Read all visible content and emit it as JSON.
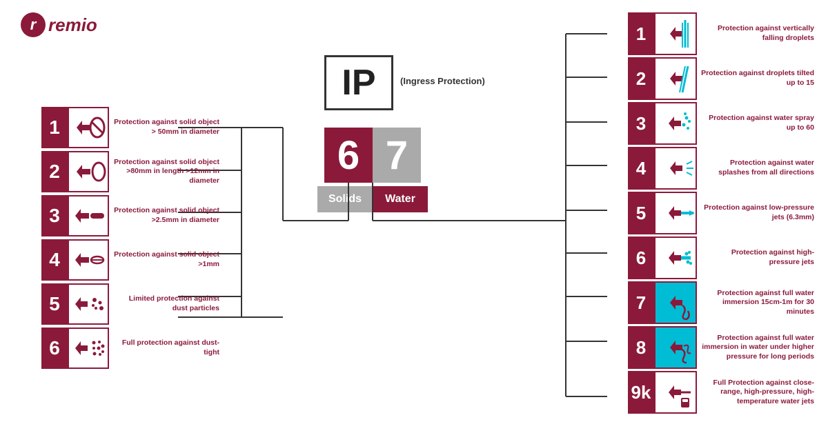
{
  "logo": {
    "p_letter": "r",
    "brand": "remio"
  },
  "ip": {
    "label": "IP",
    "subtitle": "(Ingress Protection)"
  },
  "digits": {
    "solid_digit": "6",
    "water_digit": "7",
    "solid_label": "Solids",
    "water_label": "Water"
  },
  "solids": [
    {
      "num": "1",
      "desc": "Protection against solid object > 50mm in diameter"
    },
    {
      "num": "2",
      "desc": "Protection against solid object >80mm in length >12mm in diameter"
    },
    {
      "num": "3",
      "desc": "Protection against solid object >2.5mm in diameter"
    },
    {
      "num": "4",
      "desc": "Protection against solid object >1mm"
    },
    {
      "num": "5",
      "desc": "Limited protection against dust particles"
    },
    {
      "num": "6",
      "desc": "Full protection against dust-tight"
    }
  ],
  "water": [
    {
      "num": "1",
      "desc": "Protection against vertically falling droplets",
      "active": false
    },
    {
      "num": "2",
      "desc": "Protection against droplets tilted up to 15",
      "active": false
    },
    {
      "num": "3",
      "desc": "Protection against water spray up to 60",
      "active": false
    },
    {
      "num": "4",
      "desc": "Protection against water splashes from all directions",
      "active": false
    },
    {
      "num": "5",
      "desc": "Protection against low-pressure jets (6.3mm)",
      "active": false
    },
    {
      "num": "6",
      "desc": "Protection against high-pressure jets",
      "active": false
    },
    {
      "num": "7",
      "desc": "Protection against full water immersion 15cm-1m for 30 minutes",
      "active": true
    },
    {
      "num": "8",
      "desc": "Protection against full water immersion in water under higher pressure for long periods",
      "active": true
    },
    {
      "num": "9k",
      "desc": "Full Protection against close-range, high-pressure, high-temperature water jets",
      "active": false
    }
  ]
}
